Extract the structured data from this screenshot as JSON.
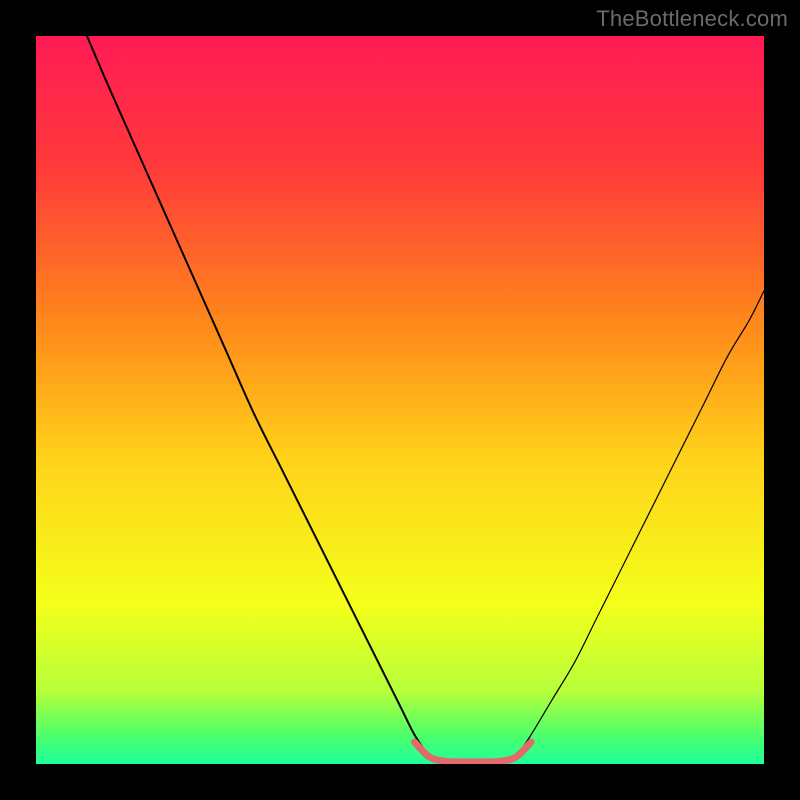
{
  "watermark": "TheBottleneck.com",
  "chart_data": {
    "type": "line",
    "title": "",
    "xlabel": "",
    "ylabel": "",
    "xlim": [
      0,
      100
    ],
    "ylim": [
      0,
      100
    ],
    "grid": false,
    "legend": false,
    "background_gradient_stops": [
      {
        "offset": 0.0,
        "color": "#ff1b55"
      },
      {
        "offset": 0.18,
        "color": "#ff3a3a"
      },
      {
        "offset": 0.4,
        "color": "#ff8a1a"
      },
      {
        "offset": 0.58,
        "color": "#ffd21a"
      },
      {
        "offset": 0.78,
        "color": "#f4ff1a"
      },
      {
        "offset": 0.9,
        "color": "#b6ff3a"
      },
      {
        "offset": 0.96,
        "color": "#4eff6a"
      },
      {
        "offset": 1.0,
        "color": "#1eff9a"
      }
    ],
    "series": [
      {
        "name": "bottleneck-curve-left",
        "stroke": "#000000",
        "stroke_width": 2.0,
        "x": [
          7,
          10,
          14,
          18,
          22,
          26,
          30,
          34,
          38,
          42,
          46,
          50,
          52,
          54
        ],
        "y": [
          100,
          93,
          84,
          75,
          66,
          57,
          48,
          40,
          32,
          24,
          16,
          8,
          4,
          1
        ]
      },
      {
        "name": "bottleneck-curve-right",
        "stroke": "#000000",
        "stroke_width": 1.2,
        "x": [
          66,
          68,
          71,
          74,
          77,
          80,
          83,
          86,
          89,
          92,
          95,
          98,
          100
        ],
        "y": [
          1,
          4,
          9,
          14,
          20,
          26,
          32,
          38,
          44,
          50,
          56,
          61,
          65
        ]
      },
      {
        "name": "optimal-band",
        "stroke": "#e26a6a",
        "stroke_width": 7,
        "linecap": "round",
        "x": [
          52,
          54,
          56,
          58,
          60,
          62,
          64,
          66,
          68
        ],
        "y": [
          3.0,
          1.0,
          0.4,
          0.3,
          0.3,
          0.3,
          0.4,
          1.0,
          3.0
        ]
      }
    ]
  }
}
